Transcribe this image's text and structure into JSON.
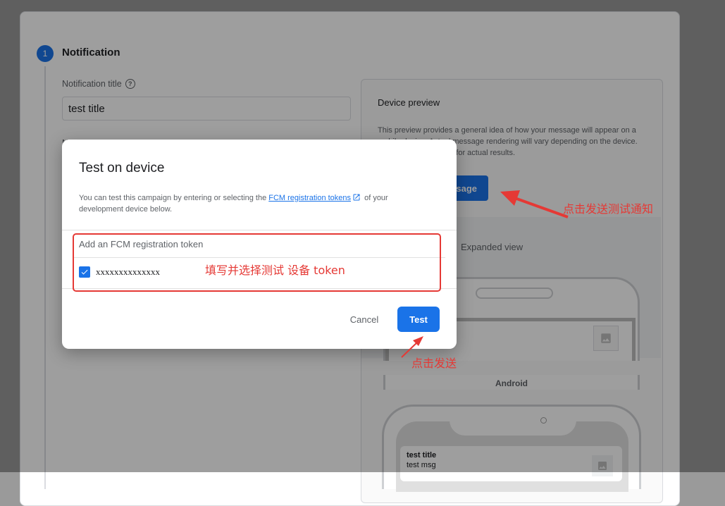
{
  "step": {
    "number": "1",
    "title": "Notification"
  },
  "notification_form": {
    "title_label": "Notification title",
    "title_value": "test title"
  },
  "preview": {
    "heading": "Device preview",
    "description": "This preview provides a general idea of how your message will appear on a mobile device. Actual message rendering will vary depending on the device. Test with a real device for actual results.",
    "send_button_visible": "sage",
    "expanded_tab": "Expanded view",
    "android_label": "Android",
    "notification_title": "test title",
    "notification_msg": "test msg"
  },
  "dialog": {
    "title": "Test on device",
    "desc_prefix": "You can test this campaign by entering or selecting the ",
    "desc_link": "FCM registration tokens",
    "desc_suffix": " of your development device below.",
    "token_placeholder": "Add an FCM registration token",
    "token_value": "xxxxxxxxxxxxxx",
    "token_checked": true,
    "cancel_label": "Cancel",
    "test_label": "Test"
  },
  "annotations": {
    "send_test_notification": "点击发送测试通知",
    "fill_and_select_token": "填写并选择测试 设备 token",
    "click_send": "点击发送"
  },
  "colors": {
    "primary": "#1a73e8",
    "annotation": "#e53935"
  }
}
